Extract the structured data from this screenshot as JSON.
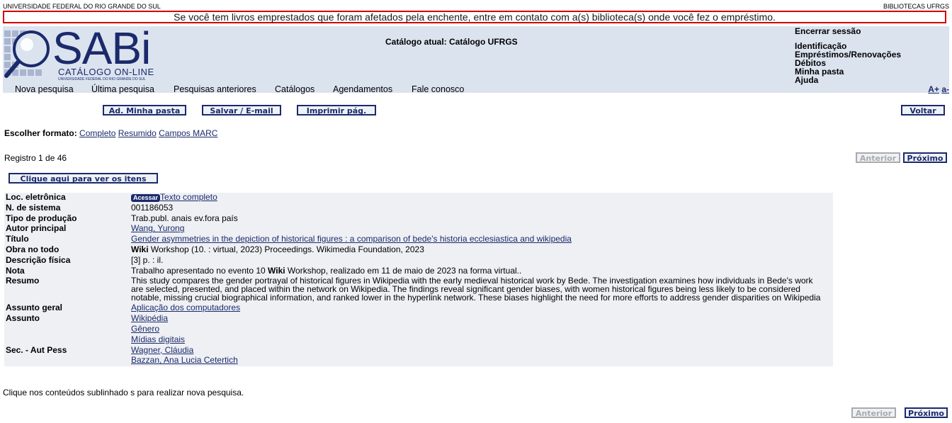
{
  "top": {
    "university": "UNIVERSIDADE FEDERAL DO RIO GRANDE DO SUL",
    "libraries": "BIBLIOTECAS UFRGS"
  },
  "alert": "Se você tem livros emprestados que foram afetados pela enchente, entre em contato com a(s) biblioteca(s) onde você fez o empréstimo.",
  "logo": {
    "name": "SABi",
    "sub": "CATÁLOGO ON-LINE",
    "tiny": "UNIVERSIDADE FEDERAL DO RIO GRANDE DO SUL"
  },
  "catalog_line": "Catálogo atual: Catálogo UFRGS",
  "account_links": {
    "logout": "Encerrar sessão",
    "items": [
      "Identificação",
      "Empréstimos/Renovações",
      "Débitos",
      "Minha pasta",
      "Ajuda"
    ]
  },
  "nav": [
    "Nova pesquisa",
    "Última pesquisa",
    "Pesquisas anteriores",
    "Catálogos",
    "Agendamentos",
    "Fale conosco"
  ],
  "font_size": {
    "bigger": "A+",
    "smaller": "a-"
  },
  "buttons": {
    "add_folder": "Ad. Minha pasta",
    "save_email": "Salvar / E-mail",
    "print": "Imprimir pág.",
    "back": "Voltar",
    "prev": "Anterior",
    "next": "Próximo",
    "items": "Clique aqui para ver os itens"
  },
  "format": {
    "label": "Escolher formato:",
    "options": [
      "Completo",
      "Resumido",
      "Campos MARC"
    ]
  },
  "record_count": "Registro 1 de 46",
  "record": {
    "loc_label": "Loc. eletrônica",
    "loc_badge": "Acessar",
    "loc_link": "Texto completo",
    "sys_label": "N. de sistema",
    "sys_value": "001186053",
    "type_label": "Tipo de produção",
    "type_value": "Trab.publ. anais ev.fora país",
    "author_label": "Autor principal",
    "author_value": "Wang, Yurong",
    "title_label": "Título",
    "title_value": "Gender asymmetries in the depiction of historical figures : a comparison of bede's historia ecclesiastica and wikipedia",
    "work_label": "Obra no todo",
    "work_bold": "Wiki",
    "work_rest": " Workshop (10. : virtual, 2023) Proceedings. Wikimedia Foundation, 2023",
    "phys_label": "Descrição física",
    "phys_value": "[3] p. : il.",
    "note_label": "Nota",
    "note_pre": "Trabalho apresentado no evento 10 ",
    "note_bold": "Wiki",
    "note_post": " Workshop, realizado em 11 de maio de 2023 na forma virtual..",
    "abstract_label": "Resumo",
    "abstract_value": "This study compares the gender portrayal of historical figures in Wikipedia with the early medieval historical work by Bede. The investigation examines how individuals in Bede's work are selected, presented, and placed within the network on Wikipedia. The findings reveal significant gender biases, with women historical figures being less likely to be considered notable, missing crucial biographical information, and ranked lower in the hyperlink network. These biases highlight the need for more efforts to address gender disparities on Wikipedia",
    "general_subject_label": "Assunto geral",
    "general_subject_value": "Aplicação dos computadores",
    "subject_label": "Assunto",
    "subjects": [
      "Wikipédia",
      "Gênero",
      "Mídias digitais"
    ],
    "sec_label": "Sec. - Aut Pess",
    "sec_authors": [
      "Wagner, Cláudia",
      "Bazzan, Ana Lucia Cetertich"
    ]
  },
  "footer_note": "Clique nos conteúdos sublinhado s para realizar nova pesquisa."
}
